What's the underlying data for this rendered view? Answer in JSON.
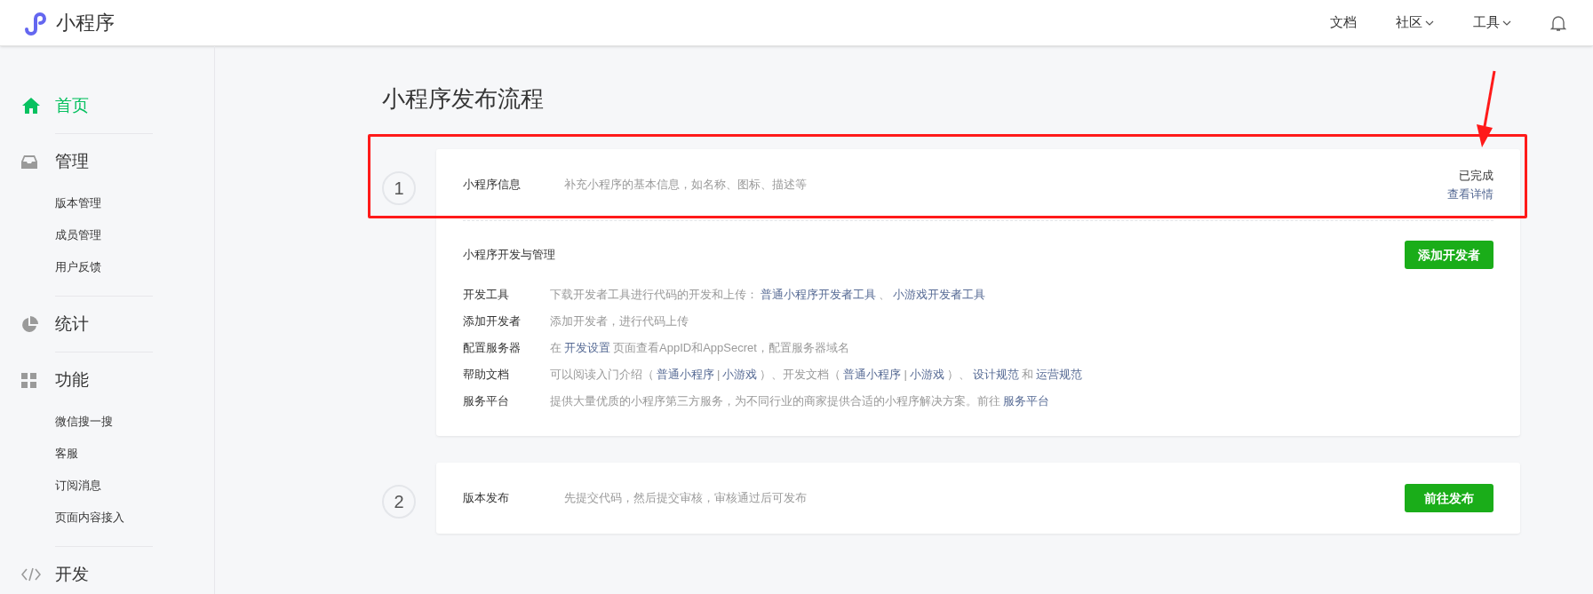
{
  "header": {
    "logo_text": "小程序",
    "nav": [
      {
        "label": "文档",
        "has_menu": false
      },
      {
        "label": "社区",
        "has_menu": true
      },
      {
        "label": "工具",
        "has_menu": true
      }
    ]
  },
  "sidebar": {
    "sections": [
      {
        "label": "首页",
        "kind": "home",
        "selected": true
      },
      {
        "label": "管理",
        "kind": "inbox",
        "selected": false,
        "items": [
          {
            "label": "版本管理"
          },
          {
            "label": "成员管理"
          },
          {
            "label": "用户反馈"
          }
        ]
      },
      {
        "label": "统计",
        "kind": "pie",
        "selected": false
      },
      {
        "label": "功能",
        "kind": "grid",
        "selected": false,
        "items": [
          {
            "label": "微信搜一搜"
          },
          {
            "label": "客服"
          },
          {
            "label": "订阅消息"
          },
          {
            "label": "页面内容接入"
          }
        ]
      },
      {
        "label": "开发",
        "kind": "code",
        "selected": false
      }
    ]
  },
  "page_title": "小程序发布流程",
  "steps": [
    {
      "number": "1",
      "title": "小程序信息",
      "description": "补充小程序的基本信息，如名称、图标、描述等",
      "status": "已完成",
      "link": "查看详情",
      "highlighted": true,
      "section": {
        "title": "小程序开发与管理",
        "button": "添加开发者",
        "rows": [
          {
            "label": "开发工具",
            "parts": [
              {
                "kind": "text",
                "text": "下载开发者工具进行代码的开发和上传："
              },
              {
                "kind": "link",
                "text": "普通小程序开发者工具"
              },
              {
                "kind": "text",
                "text": "、"
              },
              {
                "kind": "link",
                "text": "小游戏开发者工具"
              }
            ]
          },
          {
            "label": "添加开发者",
            "parts": [
              {
                "kind": "text",
                "text": "添加开发者，进行代码上传"
              }
            ]
          },
          {
            "label": "配置服务器",
            "parts": [
              {
                "kind": "text",
                "text": "在"
              },
              {
                "kind": "link",
                "text": "开发设置"
              },
              {
                "kind": "text",
                "text": "页面查看AppID和AppSecret，配置服务器域名"
              }
            ]
          },
          {
            "label": "帮助文档",
            "parts": [
              {
                "kind": "text",
                "text": "可以阅读入门介绍（"
              },
              {
                "kind": "link",
                "text": "普通小程序"
              },
              {
                "kind": "text",
                "text": "|"
              },
              {
                "kind": "link",
                "text": "小游戏"
              },
              {
                "kind": "text",
                "text": "）、开发文档（"
              },
              {
                "kind": "link",
                "text": "普通小程序"
              },
              {
                "kind": "text",
                "text": "|"
              },
              {
                "kind": "link",
                "text": "小游戏"
              },
              {
                "kind": "text",
                "text": "）、"
              },
              {
                "kind": "link",
                "text": "设计规范"
              },
              {
                "kind": "text",
                "text": "和"
              },
              {
                "kind": "link",
                "text": "运营规范"
              }
            ]
          },
          {
            "label": "服务平台",
            "parts": [
              {
                "kind": "text",
                "text": "提供大量优质的小程序第三方服务，为不同行业的商家提供合适的小程序解决方案。前往"
              },
              {
                "kind": "link",
                "text": "服务平台"
              }
            ]
          }
        ]
      }
    },
    {
      "number": "2",
      "title": "版本发布",
      "description": "先提交代码，然后提交审核，审核通过后可发布",
      "button": "前往发布",
      "highlighted": false
    }
  ]
}
